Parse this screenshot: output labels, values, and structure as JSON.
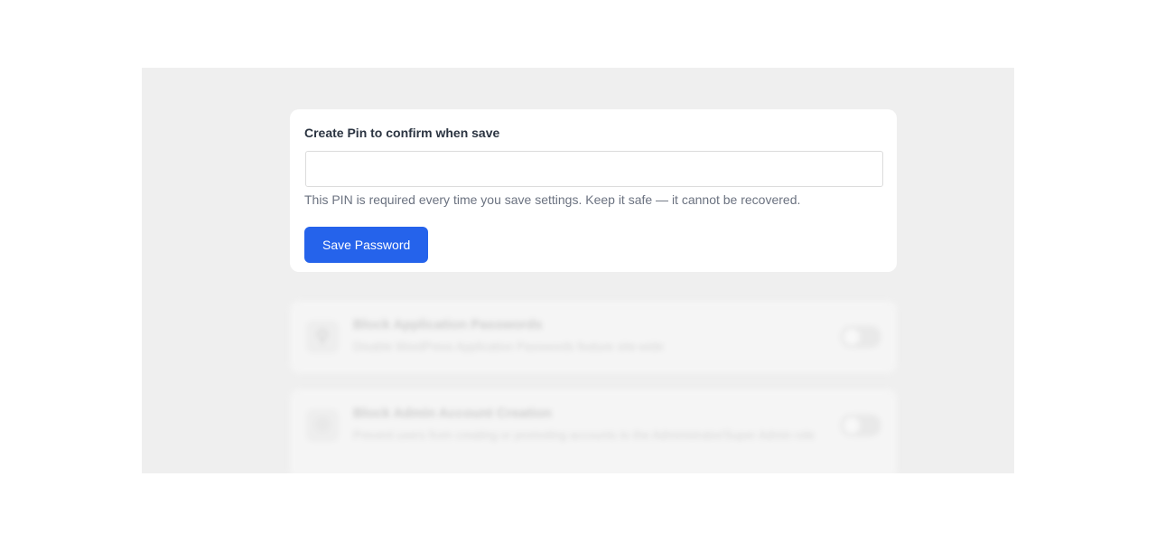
{
  "pin_modal": {
    "label": "Create Pin to confirm when save",
    "input_value": "",
    "input_placeholder": "",
    "help_text": "This PIN is required every time you save settings. Keep it safe — it cannot be recovered.",
    "save_label": "Save Password"
  },
  "settings": [
    {
      "icon": "key-icon",
      "title": "Block Application Passwords",
      "description": "Disable WordPress Application Passwords feature site-wide"
    },
    {
      "icon": "shield-icon",
      "title": "Block Admin Account Creation",
      "description": "Prevent users from creating or promoting accounts to the Administrator/Super Admin role"
    }
  ],
  "colors": {
    "accent": "#2563eb",
    "backdrop": "#efefef",
    "card": "#ffffff"
  }
}
